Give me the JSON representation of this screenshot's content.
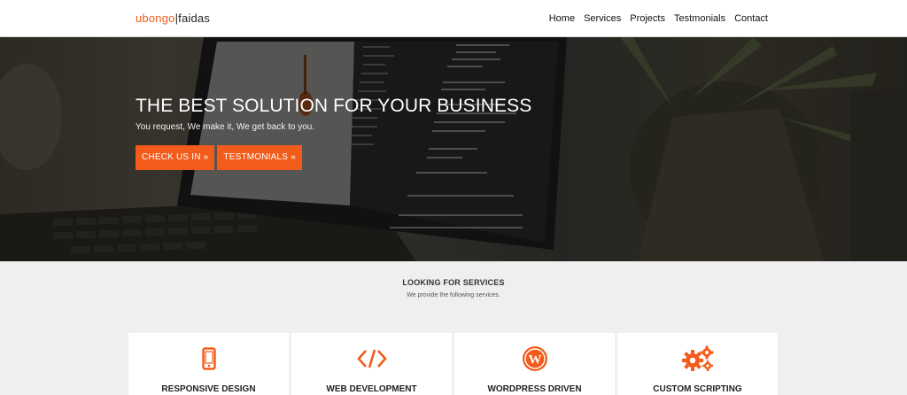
{
  "brand": {
    "part1": "ubongo",
    "separator": "|",
    "part2": "faidas"
  },
  "nav": {
    "home": "Home",
    "services": "Services",
    "projects": "Projects",
    "testimonials": "Testmonials",
    "contact": "Contact"
  },
  "hero": {
    "title": "THE BEST SOLUTION FOR YOUR BUSINESS",
    "subtitle": "You request, We make it, We get back to you.",
    "btn1": "CHECK US IN »",
    "btn2": "TESTMONIALS »"
  },
  "services": {
    "title": "LOOKING FOR SERVICES",
    "subtitle": "We provide the following services.",
    "items": [
      {
        "label": "RESPONSIVE DESIGN",
        "icon": "mobile-icon"
      },
      {
        "label": "WEB DEVELOPMENT",
        "icon": "code-icon"
      },
      {
        "label": "WORDPRESS DRIVEN",
        "icon": "wordpress-icon"
      },
      {
        "label": "CUSTOM SCRIPTING",
        "icon": "gears-icon"
      }
    ]
  },
  "colors": {
    "accent": "#f35b1b",
    "page_bg": "#efefef",
    "nav_bg": "#ffffff"
  }
}
